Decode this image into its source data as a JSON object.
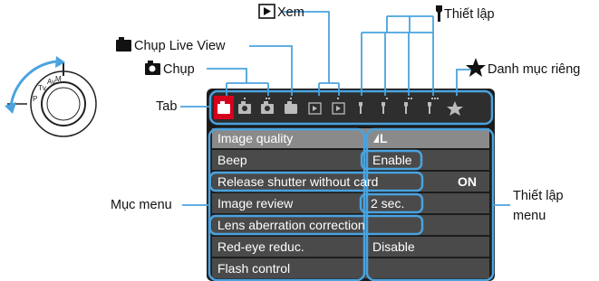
{
  "labels": {
    "xem": "Xem",
    "chup_live_view": "Chụp Live View",
    "chup": "Chụp",
    "tab": "Tab",
    "thiet_lap": "Thiết lập",
    "danh_muc_rieng": "Danh mục riêng",
    "muc_menu": "Mục menu",
    "thiet_lap_menu_line1": "Thiết lập",
    "thiet_lap_menu_line2": "menu"
  },
  "menu": {
    "items": [
      {
        "name": "Image quality",
        "value": "L"
      },
      {
        "name": "Beep",
        "value": "Enable"
      },
      {
        "name": "Release shutter without card",
        "value": "ON"
      },
      {
        "name": "Image review",
        "value": "2 sec."
      },
      {
        "name": "Lens aberration correction",
        "value": ""
      },
      {
        "name": "Red-eye reduc.",
        "value": "Disable"
      },
      {
        "name": "Flash control",
        "value": ""
      }
    ]
  },
  "colors": {
    "accent_red": "#d6001c",
    "highlight_blue": "#4aa3df",
    "screen_bg": "#1c1c1c",
    "row_bg": "#4a4a4a",
    "selected_row_bg": "#8a8a8a"
  },
  "icons": [
    "camera-icon",
    "play-icon",
    "wrench-icon",
    "star-icon",
    "mode-dial-icon"
  ]
}
